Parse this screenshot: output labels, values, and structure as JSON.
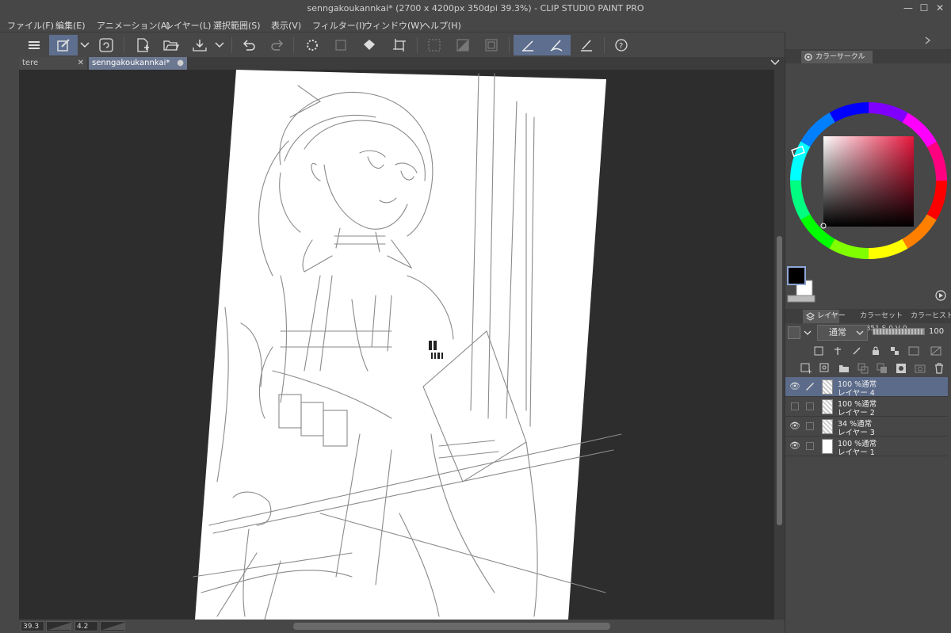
{
  "window": {
    "title": "senngakoukannkai* (2700 x 4200px 350dpi 39.3%)  - CLIP STUDIO PAINT PRO",
    "minimize": "—",
    "maximize": "☐",
    "close": "✕"
  },
  "menu": [
    "ファイル(F)",
    "編集(E)",
    "アニメーション(A)",
    "レイヤー(L)",
    "選択範囲(S)",
    "表示(V)",
    "フィルター(I)",
    "ウィンドウ(W)",
    "ヘルプ(H)"
  ],
  "tabs": [
    {
      "label": "tere",
      "close": "✕"
    },
    {
      "label": "senngakoukannkai*",
      "close": "●"
    }
  ],
  "status": {
    "zoom": "39.3",
    "rotation": "4.2"
  },
  "color_panel": {
    "tab": "カラーサークル",
    "hsv": "H 351 S  0 V  0",
    "main_color": "#000000",
    "sub_color": "#ffffff",
    "hue_color": "#e8163c"
  },
  "layer_panel": {
    "tabs": [
      "レイヤー",
      "カラーセット",
      "カラーヒストリー"
    ],
    "blend_mode": "通常",
    "opacity": "100",
    "layers": [
      {
        "opacity_mode": "100 %通常",
        "name": "レイヤー 4",
        "selected": true,
        "visible": true,
        "editing": true
      },
      {
        "opacity_mode": "100 %通常",
        "name": "レイヤー 2",
        "selected": false,
        "visible": false,
        "editing": false
      },
      {
        "opacity_mode": "34 %通常",
        "name": "レイヤー 3",
        "selected": false,
        "visible": true,
        "editing": false
      },
      {
        "opacity_mode": "100 %通常",
        "name": "レイヤー 1",
        "selected": false,
        "visible": true,
        "editing": false
      }
    ]
  }
}
